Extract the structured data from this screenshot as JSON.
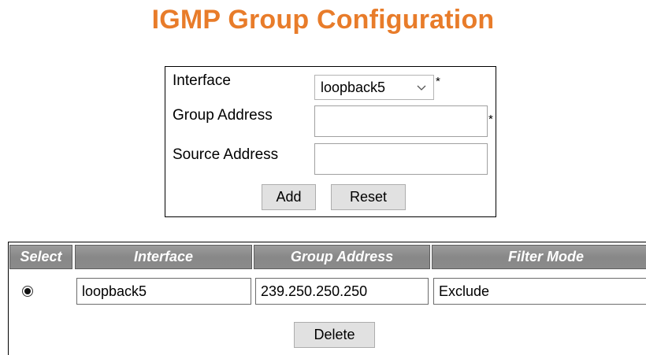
{
  "page": {
    "title": "IGMP Group Configuration"
  },
  "form": {
    "interface_label": "Interface",
    "interface_value": "loopback5",
    "group_address_label": "Group Address",
    "group_address_value": "",
    "source_address_label": "Source Address",
    "source_address_value": "",
    "required_marker": "*",
    "add_label": "Add",
    "reset_label": "Reset",
    "dropdown_icon": "chevron-down-icon"
  },
  "table": {
    "headers": [
      "Select",
      "Interface",
      "Group Address",
      "Filter Mode"
    ],
    "rows": [
      {
        "selected": true,
        "interface": "loopback5",
        "group_address": "239.250.250.250",
        "filter_mode": "Exclude"
      }
    ],
    "delete_label": "Delete"
  },
  "colors": {
    "title": "#e87c2a",
    "header_bg": "#8f8f8f",
    "header_text": "#ffffff",
    "button_bg": "#e1e1e1"
  }
}
